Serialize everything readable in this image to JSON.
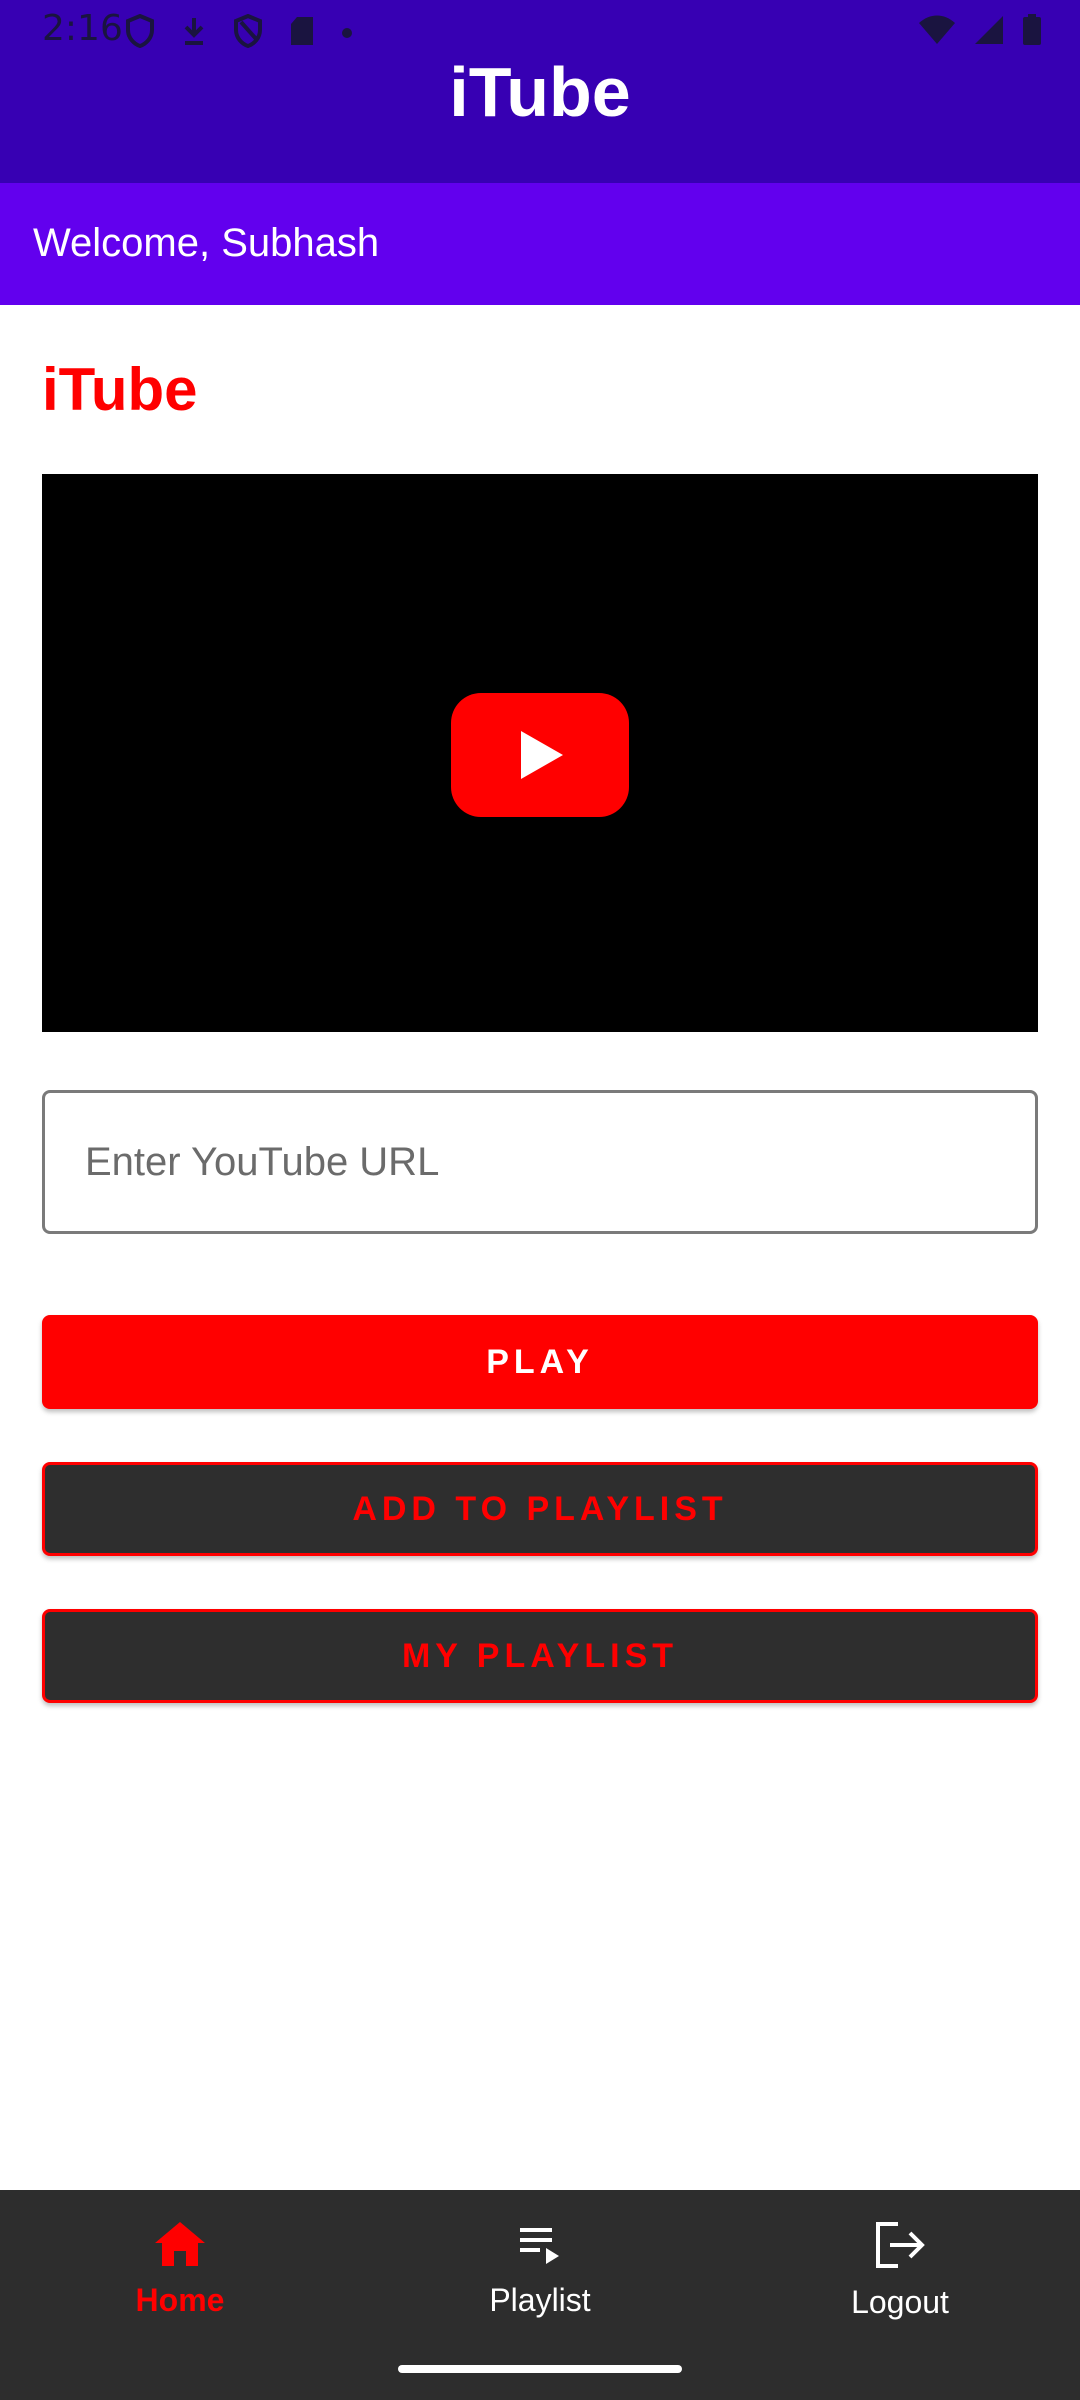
{
  "status_bar": {
    "time": "2:16",
    "icons_left": [
      "shield-icon",
      "download-icon",
      "shield-icon",
      "sd-card-icon",
      "dot-icon"
    ],
    "icons_right": [
      "wifi-icon",
      "signal-icon",
      "battery-icon"
    ]
  },
  "app_bar": {
    "title": "iTube",
    "color": "#3700b3"
  },
  "welcome": {
    "text": "Welcome, Subhash",
    "color": "#6200ee"
  },
  "main": {
    "brand_title": "iTube",
    "video_player": {
      "icon": "youtube-play-icon"
    },
    "url_input": {
      "placeholder": "Enter YouTube URL",
      "value": ""
    },
    "buttons": {
      "play": "PLAY",
      "add_to_playlist": "ADD TO PLAYLIST",
      "my_playlist": "MY PLAYLIST"
    }
  },
  "bottom_nav": {
    "items": [
      {
        "label": "Home",
        "icon": "home-icon",
        "active": true
      },
      {
        "label": "Playlist",
        "icon": "playlist-icon",
        "active": false
      },
      {
        "label": "Logout",
        "icon": "logout-icon",
        "active": false
      }
    ]
  },
  "colors": {
    "accent": "#ff0000",
    "button_dark": "#2e2e2e",
    "nav_background": "#2d2d2d"
  }
}
